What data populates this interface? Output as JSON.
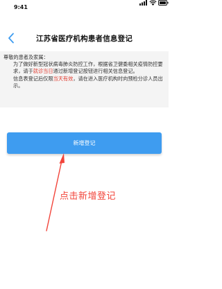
{
  "status_bar": {
    "time": "9:41",
    "icons": [
      "signal-icon",
      "wifi-icon",
      "battery-icon"
    ]
  },
  "nav": {
    "back_icon": "chevron-left-icon",
    "title": "江苏省医疗机构患者信息登记"
  },
  "notice": {
    "greeting": "尊敬的患者及家属：",
    "para1_a": "为了做好新型冠状病毒肺炎防控工作，根据省卫健委相关疫情防控要求，请于",
    "para1_highlight": "就诊当日",
    "para1_b": "通过新增登记按钮进行相关信息登记。",
    "para2_a": "信息表登记后仅限",
    "para2_highlight": "当天有效",
    "para2_b": "，请在进入医疗机构时向预检分诊人员出示。"
  },
  "button": {
    "label": "新增登记"
  },
  "annotation": {
    "label": "点击新增登记"
  },
  "colors": {
    "accent_blue": "#3e9cf0",
    "highlight_red": "#e03a2e",
    "annotation_red": "#f2443a",
    "notice_bg": "#f4f4f4"
  }
}
